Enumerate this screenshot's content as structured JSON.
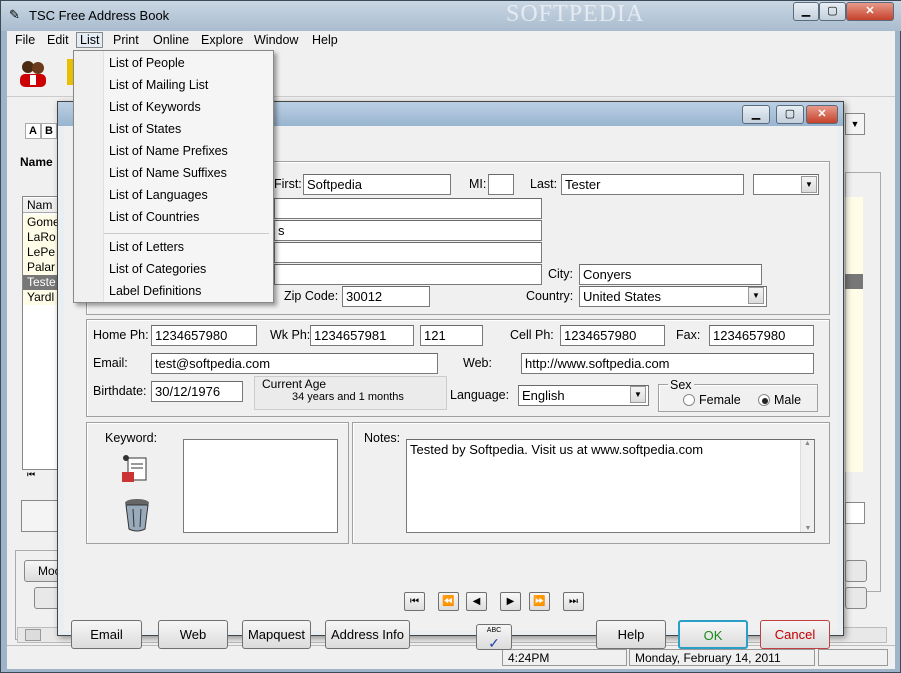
{
  "window": {
    "title": "TSC Free Address Book",
    "watermark": "SOFTPEDIA"
  },
  "menubar": [
    "File",
    "Edit",
    "List",
    "Print",
    "Online",
    "Explore",
    "Window",
    "Help"
  ],
  "list_menu": {
    "group1": [
      "List of People",
      "List of Mailing List",
      "List of Keywords",
      "List of States",
      "List of Name Prefixes",
      "List of Name Suffixes",
      "List of Languages",
      "List of Countries"
    ],
    "group2": [
      "List of Letters",
      "List of Categories",
      "Label Definitions"
    ]
  },
  "alpha_tabs": [
    "A",
    "B"
  ],
  "background": {
    "name_header": "Name",
    "col_header": "Nam",
    "rows": [
      "Gome",
      "LaRo",
      "LePe",
      "Palar",
      "Teste",
      "Yardl"
    ],
    "mod_button": "Moc"
  },
  "form": {
    "first_label": "First:",
    "first_value": "Softpedia",
    "mi_label": "MI:",
    "mi_value": "",
    "last_label": "Last:",
    "last_value": "Tester",
    "addr2_partial": "s",
    "city_label": "City:",
    "city_value": "Conyers",
    "zip_label": "Zip Code:",
    "zip_value": "30012",
    "country_label": "Country:",
    "country_value": "United States",
    "home_label": "Home Ph:",
    "home_value": "1234657980",
    "wk_label": "Wk Ph:",
    "wk_value": "1234657981",
    "ext_value": "121",
    "cell_label": "Cell Ph:",
    "cell_value": "1234657980",
    "fax_label": "Fax:",
    "fax_value": "1234657980",
    "email_label": "Email:",
    "email_value": "test@softpedia.com",
    "web_label": "Web:",
    "web_value": "http://www.softpedia.com",
    "birth_label": "Birthdate:",
    "birth_value": "30/12/1976",
    "age_label": "Current Age",
    "age_value": "34 years and 1 months",
    "lang_label": "Language:",
    "lang_value": "English",
    "sex_label": "Sex",
    "female_label": "Female",
    "male_label": "Male",
    "sex_selected": "Male",
    "keyword_label": "Keyword:",
    "notes_label": "Notes:",
    "notes_value": "Tested by Softpedia. Visit us at www.softpedia.com"
  },
  "buttons": {
    "email": "Email",
    "web": "Web",
    "mapquest": "Mapquest",
    "address_info": "Address Info",
    "spell": "ABC",
    "help": "Help",
    "ok": "OK",
    "cancel": "Cancel"
  },
  "status": {
    "time": "4:24PM",
    "date": "Monday, February 14, 2011"
  },
  "colors": {
    "ok_text": "#1a8a1a",
    "cancel_text": "#c00000",
    "cancel_border": "#c04040",
    "ok_border": "#2aa0c8"
  }
}
